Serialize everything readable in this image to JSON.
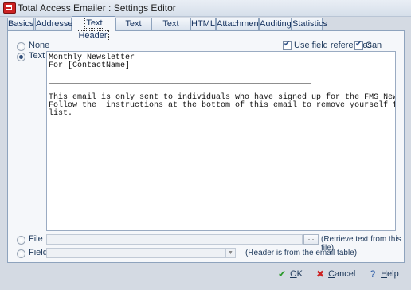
{
  "window": {
    "title": "Total Access Emailer : Settings Editor"
  },
  "tabs": [
    {
      "label": "Basics"
    },
    {
      "label": "Addresses"
    },
    {
      "label": "Text Header"
    },
    {
      "label": "Text Body"
    },
    {
      "label": "Text Footer"
    },
    {
      "label": "HTML"
    },
    {
      "label": "Attachment"
    },
    {
      "label": "Auditing"
    },
    {
      "label": "Statistics"
    }
  ],
  "active_tab": "Text Header",
  "options": {
    "none_label": "None",
    "text_label": "Text",
    "file_label": "File",
    "field_label": "Field",
    "selected": "Text"
  },
  "checkboxes": {
    "use_field_references": {
      "label": "Use field references",
      "checked": true
    },
    "can_shrink": {
      "label": "Can Shrink",
      "checked": true
    }
  },
  "header_text": "Monthly Newsletter\nFor [ContactName]\n\n_______________________________________________________\n\nThis email is only sent to individuals who have signed up for the FMS Newsletter.\nFollow the  instructions at the bottom of this email to remove yourself from this\nlist.\n______________________________________________________",
  "file": {
    "value": "",
    "browse_label": "...",
    "hint": "(Retrieve text from this file)"
  },
  "field": {
    "value": "",
    "hint": "(Header is from the email table)"
  },
  "buttons": {
    "ok_first": "O",
    "ok_rest": "K",
    "cancel_first": "C",
    "cancel_rest": "ancel",
    "help_first": "H",
    "help_rest": "elp"
  }
}
